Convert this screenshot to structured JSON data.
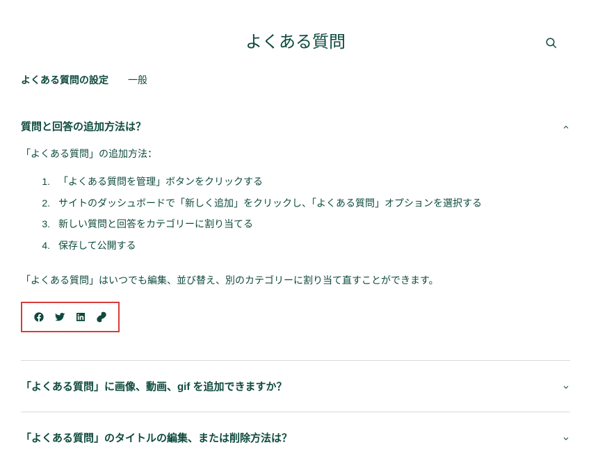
{
  "page": {
    "title": "よくある質問"
  },
  "tabs": {
    "settings": "よくある質問の設定",
    "general": "一般"
  },
  "faq1": {
    "question": "質問と回答の追加方法は？",
    "intro": "「よくある質問」の追加方法：",
    "steps": {
      "n1": "1.",
      "s1": "「よくある質問を管理」ボタンをクリックする",
      "n2": "2.",
      "s2": "サイトのダッシュボードで「新しく追加」をクリックし、「よくある質問」オプションを選択する",
      "n3": "3.",
      "s3": "新しい質問と回答をカテゴリーに割り当てる",
      "n4": "4.",
      "s4": "保存して公開する"
    },
    "outro": "「よくある質問」はいつでも編集、並び替え、別のカテゴリーに割り当て直すことができます。"
  },
  "faq2": {
    "question": "「よくある質問」に画像、動画、gif を追加できますか？"
  },
  "faq3": {
    "question": "「よくある質問」のタイトルの編集、または削除方法は？"
  }
}
